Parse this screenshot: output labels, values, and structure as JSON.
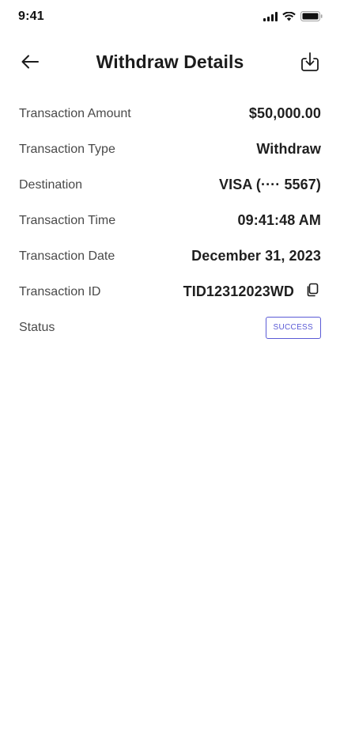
{
  "status_bar": {
    "time": "9:41",
    "icons": [
      "cellular-signal-icon",
      "wifi-icon",
      "battery-icon"
    ]
  },
  "header": {
    "title": "Withdraw Details",
    "back_icon": "arrow-left-icon",
    "download_icon": "download-icon"
  },
  "details": [
    {
      "label": "Transaction Amount",
      "value": "$50,000.00"
    },
    {
      "label": "Transaction Type",
      "value": "Withdraw"
    },
    {
      "label": "Destination",
      "value": "VISA (···· 5567)"
    },
    {
      "label": "Transaction Time",
      "value": "09:41:48 AM"
    },
    {
      "label": "Transaction Date",
      "value": "December 31, 2023"
    },
    {
      "label": "Transaction ID",
      "value": "TID12312023WD"
    },
    {
      "label": "Status",
      "value": "SUCCESS"
    }
  ],
  "colors": {
    "accent": "#5b5bd6",
    "text_primary": "#1f1f1f",
    "text_secondary": "#4a4a4a",
    "background": "#ffffff"
  }
}
